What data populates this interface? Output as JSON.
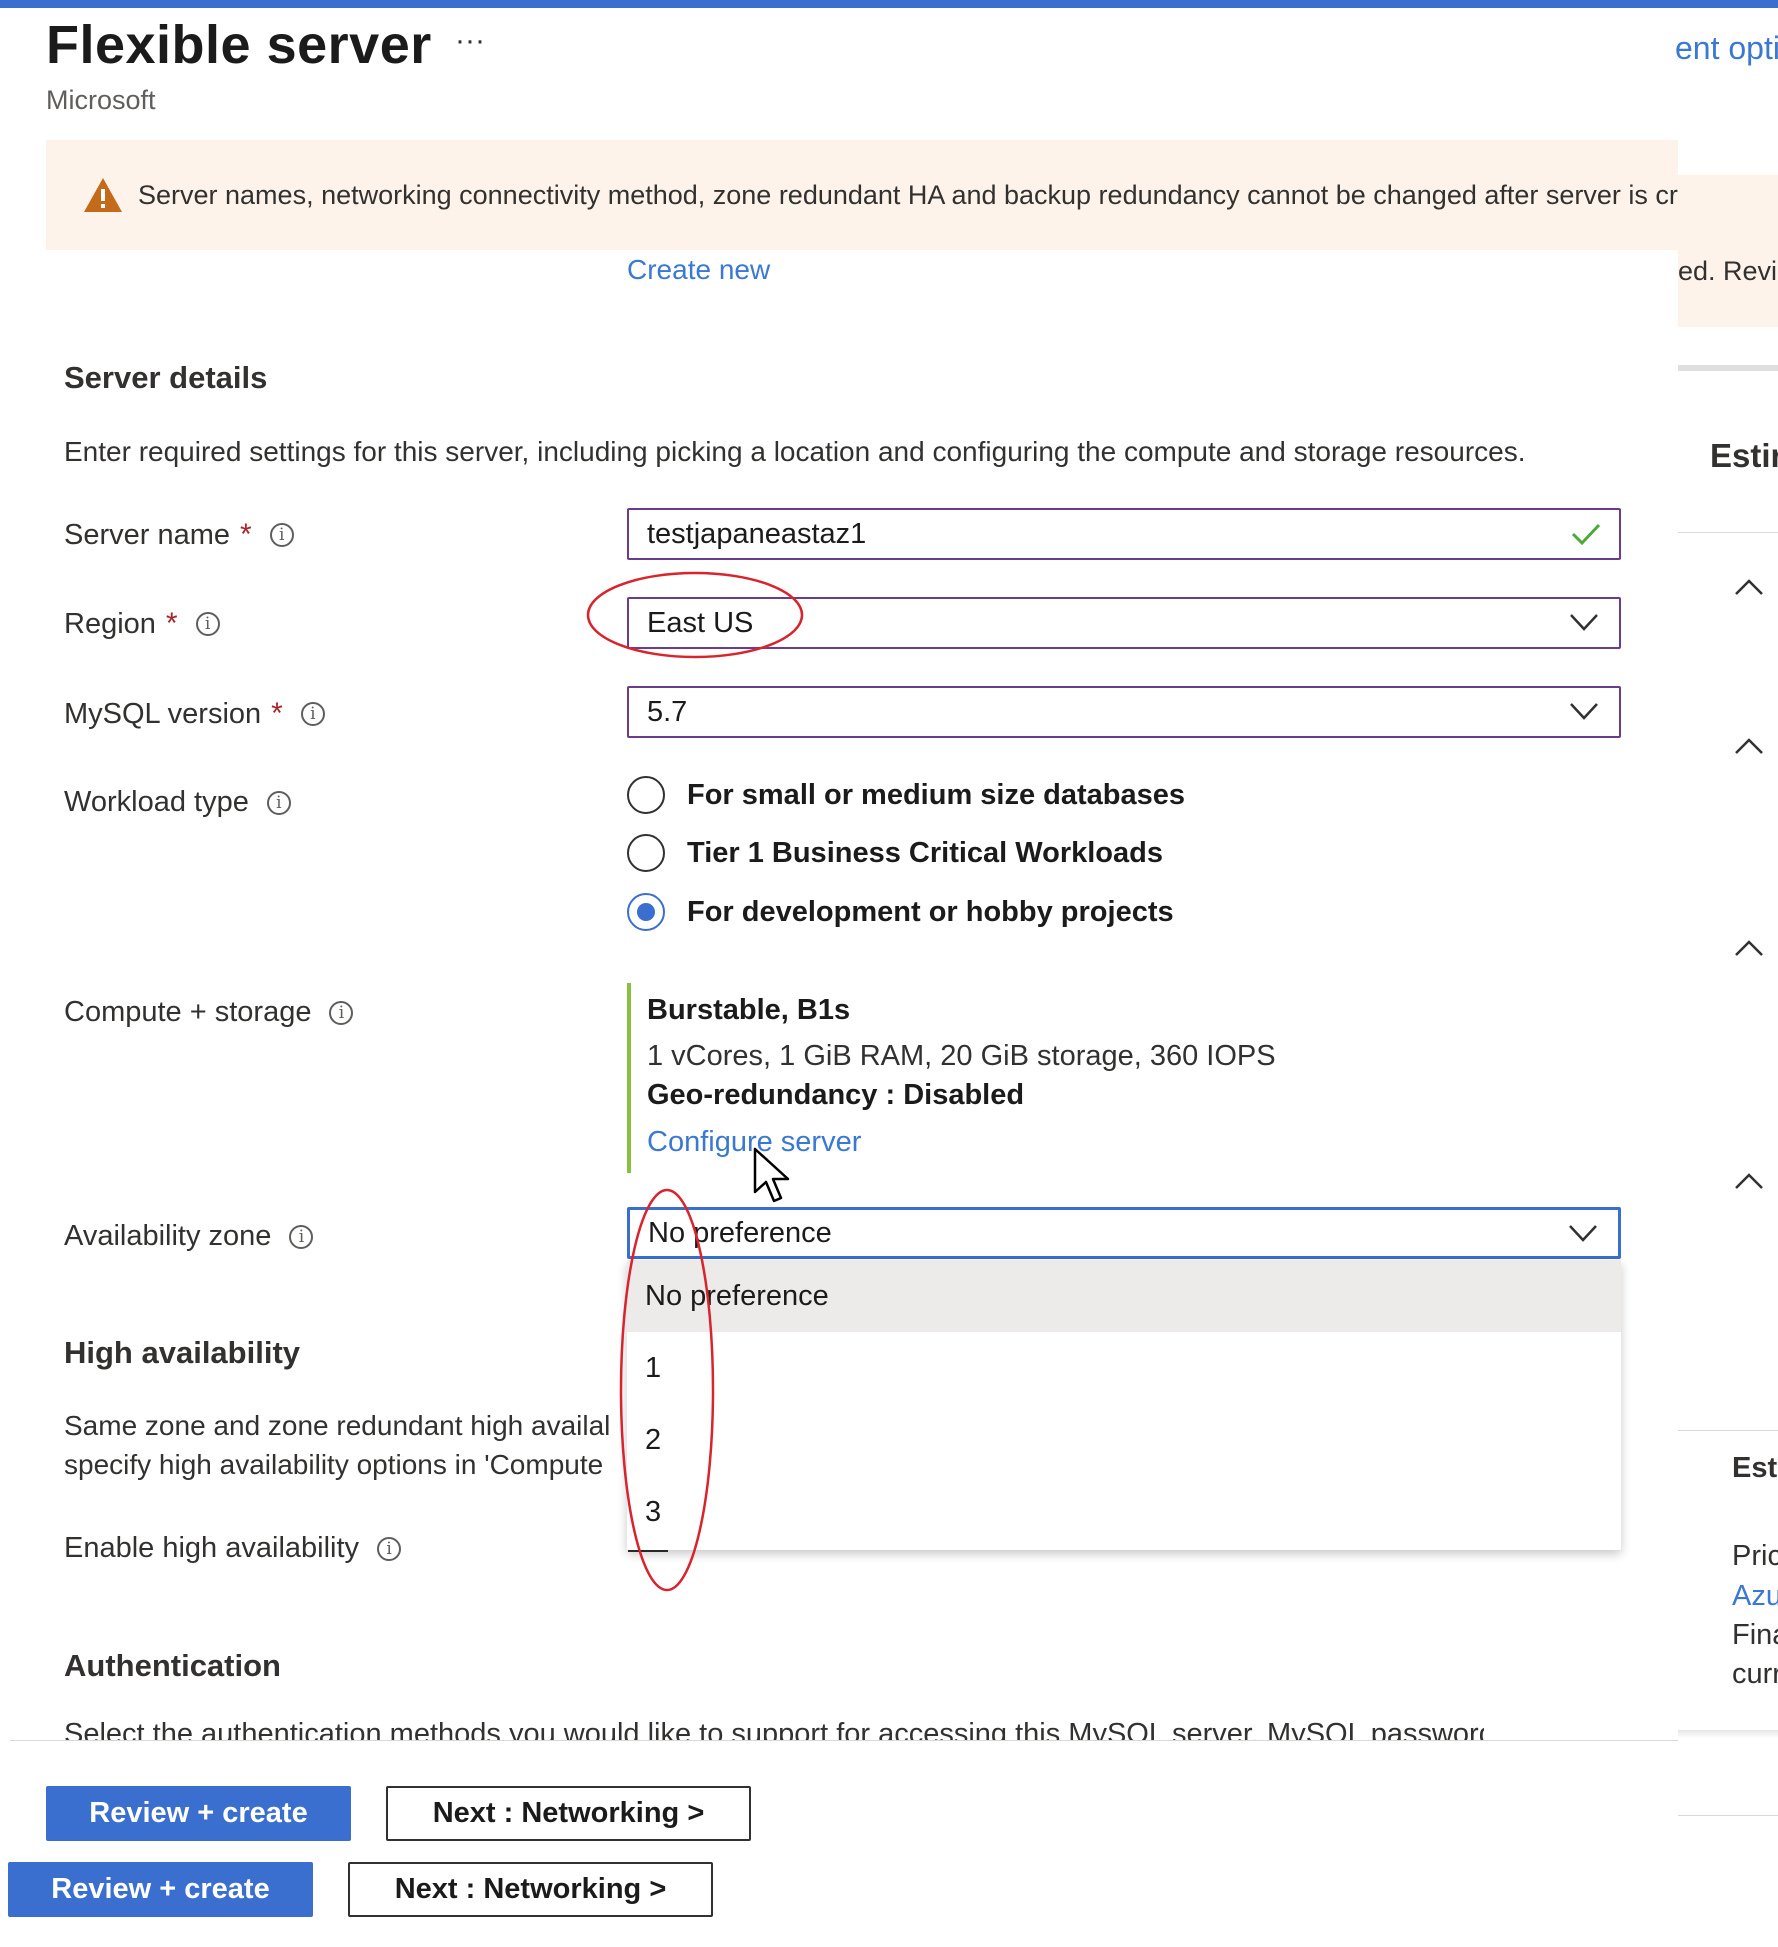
{
  "header": {
    "title": "Flexible server",
    "more_label": "···",
    "subtitle": "Microsoft",
    "top_right_link": "ent opti"
  },
  "warning": {
    "icon": "warning-icon",
    "text": "Server names, networking connectivity method, zone redundant HA and backup redundancy cannot be changed after server is cre",
    "right_snippet": "ed. Review"
  },
  "create_new_link": "Create new",
  "server_details": {
    "heading": "Server details",
    "description": "Enter required settings for this server, including picking a location and configuring the compute and storage resources.",
    "server_name": {
      "label": "Server name",
      "required": "*",
      "value": "testjapaneastaz1"
    },
    "region": {
      "label": "Region",
      "required": "*",
      "value": "East US"
    },
    "mysql_version": {
      "label": "MySQL version",
      "required": "*",
      "value": "5.7"
    },
    "workload_type": {
      "label": "Workload type",
      "options": [
        {
          "label": "For small or medium size databases",
          "checked": false
        },
        {
          "label": "Tier 1 Business Critical Workloads",
          "checked": false
        },
        {
          "label": "For development or hobby projects",
          "checked": true
        }
      ]
    },
    "compute_storage": {
      "label": "Compute + storage",
      "tier": "Burstable, B1s",
      "spec": "1 vCores, 1 GiB RAM, 20 GiB storage, 360 IOPS",
      "geo": "Geo-redundancy : Disabled",
      "configure_link": "Configure server"
    },
    "availability_zone": {
      "label": "Availability zone",
      "value": "No preference",
      "options": [
        "No preference",
        "1",
        "2",
        "3"
      ]
    }
  },
  "high_availability": {
    "heading": "High availability",
    "desc_line1": "Same zone and zone redundant high availal",
    "desc_line2": "specify high availability options in 'Compute",
    "enable_label": "Enable high availability"
  },
  "authentication": {
    "heading": "Authentication",
    "desc_clipped": "Select the authentication methods you would like to support for accessing this MySQL server. MySQL password"
  },
  "right_panel": {
    "estimate_heading": "Estir",
    "estimate_heading2": "Esti",
    "pric": "Pric",
    "azu": "Azu",
    "fina": "Fina",
    "curr": "curr"
  },
  "footer": {
    "review_create": "Review + create",
    "next_networking": "Next : Networking >"
  },
  "colors": {
    "accent": "#3a6fd0",
    "link": "#3b78d4",
    "field_border": "#6b3c8e",
    "warning_bg": "#fdf3ea",
    "compute_bar": "#8bbf3f",
    "annotation_red": "#d9232d"
  }
}
